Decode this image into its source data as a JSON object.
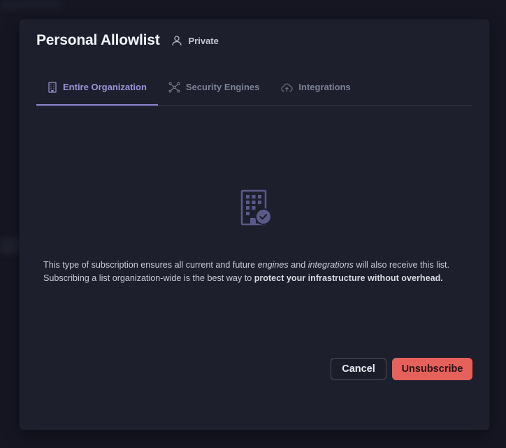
{
  "modal": {
    "title": "Personal Allowlist",
    "visibility_label": "Private",
    "visibility_icon": "user-icon"
  },
  "tabs": [
    {
      "label": "Entire Organization",
      "icon": "building-icon",
      "active": true
    },
    {
      "label": "Security Engines",
      "icon": "network-nodes-icon",
      "active": false
    },
    {
      "label": "Integrations",
      "icon": "cloud-upload-icon",
      "active": false
    }
  ],
  "content": {
    "icon": "building-check-icon",
    "line1_part1": "This type of subscription ensures all current and future ",
    "line1_em1": "engines",
    "line1_part2": " and ",
    "line1_em2": "integrations",
    "line1_part3": " will also receive this list.",
    "line2_part1": "Subscribing a list organization-wide is the best way to ",
    "line2_strong": "protect your infrastructure without overhead."
  },
  "actions": {
    "cancel_label": "Cancel",
    "unsubscribe_label": "Unsubscribe"
  },
  "colors": {
    "accent": "#8a7fcd",
    "danger": "#e5615c",
    "modal_bg": "#1d202c"
  }
}
